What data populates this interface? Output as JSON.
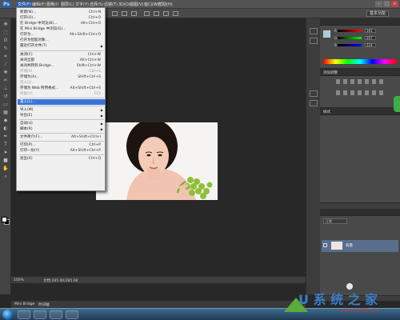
{
  "menubar": {
    "app_logo": "Ps",
    "items": [
      "文件(F)",
      "编辑(E)",
      "图像(I)",
      "图层(L)",
      "文字(Y)",
      "选择(S)",
      "滤镜(T)",
      "3D(D)",
      "视图(V)",
      "窗口(W)",
      "帮助(H)"
    ],
    "workspace_preset": "基本功能"
  },
  "file_menu": [
    {
      "label": "新建(N)...",
      "shortcut": "Ctrl+N"
    },
    {
      "label": "打开(O)...",
      "shortcut": "Ctrl+O"
    },
    {
      "label": "在 Bridge 中浏览(B)...",
      "shortcut": "Alt+Ctrl+O"
    },
    {
      "label": "在 Mini Bridge 中浏览(G)...",
      "shortcut": ""
    },
    {
      "label": "打开为...",
      "shortcut": "Alt+Shift+Ctrl+O"
    },
    {
      "label": "打开为智能对象...",
      "shortcut": ""
    },
    {
      "label": "最近打开文件(T)",
      "shortcut": ""
    },
    {
      "label": "关闭(C)",
      "shortcut": "Ctrl+W"
    },
    {
      "label": "关闭全部",
      "shortcut": "Alt+Ctrl+W"
    },
    {
      "label": "关闭并转到 Bridge...",
      "shortcut": "Shift+Ctrl+W"
    },
    {
      "label": "存储(S)",
      "shortcut": "Ctrl+S"
    },
    {
      "label": "存储为(A)...",
      "shortcut": "Shift+Ctrl+S"
    },
    {
      "label": "签入(I)...",
      "shortcut": ""
    },
    {
      "label": "存储为 Web 所用格式...",
      "shortcut": "Alt+Shift+Ctrl+S"
    },
    {
      "label": "恢复(V)",
      "shortcut": "F12"
    },
    {
      "label": "置入(L)...",
      "shortcut": ""
    },
    {
      "label": "导入(M)",
      "shortcut": ""
    },
    {
      "label": "导出(E)",
      "shortcut": ""
    },
    {
      "label": "自动(U)",
      "shortcut": ""
    },
    {
      "label": "脚本(R)",
      "shortcut": ""
    },
    {
      "label": "文件简介(F)...",
      "shortcut": "Alt+Shift+Ctrl+I"
    },
    {
      "label": "打印(P)...",
      "shortcut": "Ctrl+P"
    },
    {
      "label": "打印一份(Y)",
      "shortcut": "Alt+Shift+Ctrl+P"
    },
    {
      "label": "退出(X)",
      "shortcut": "Ctrl+Q"
    }
  ],
  "color_panel": {
    "r": "161",
    "g": "207",
    "b": "224"
  },
  "panels": {
    "adjust_tab": "添加调整",
    "styles_tab": "样式",
    "layers_blend": "正常",
    "layer_name": "背景"
  },
  "status": {
    "zoom": "100%",
    "doc_size": "文档:285.6K/285.6K"
  },
  "bottom_tabs": {
    "mini_bridge": "Mini Bridge",
    "timeline": "时间轴"
  },
  "watermark": {
    "brand": "U 系 统 之 家",
    "url": "www.30GW.com"
  }
}
